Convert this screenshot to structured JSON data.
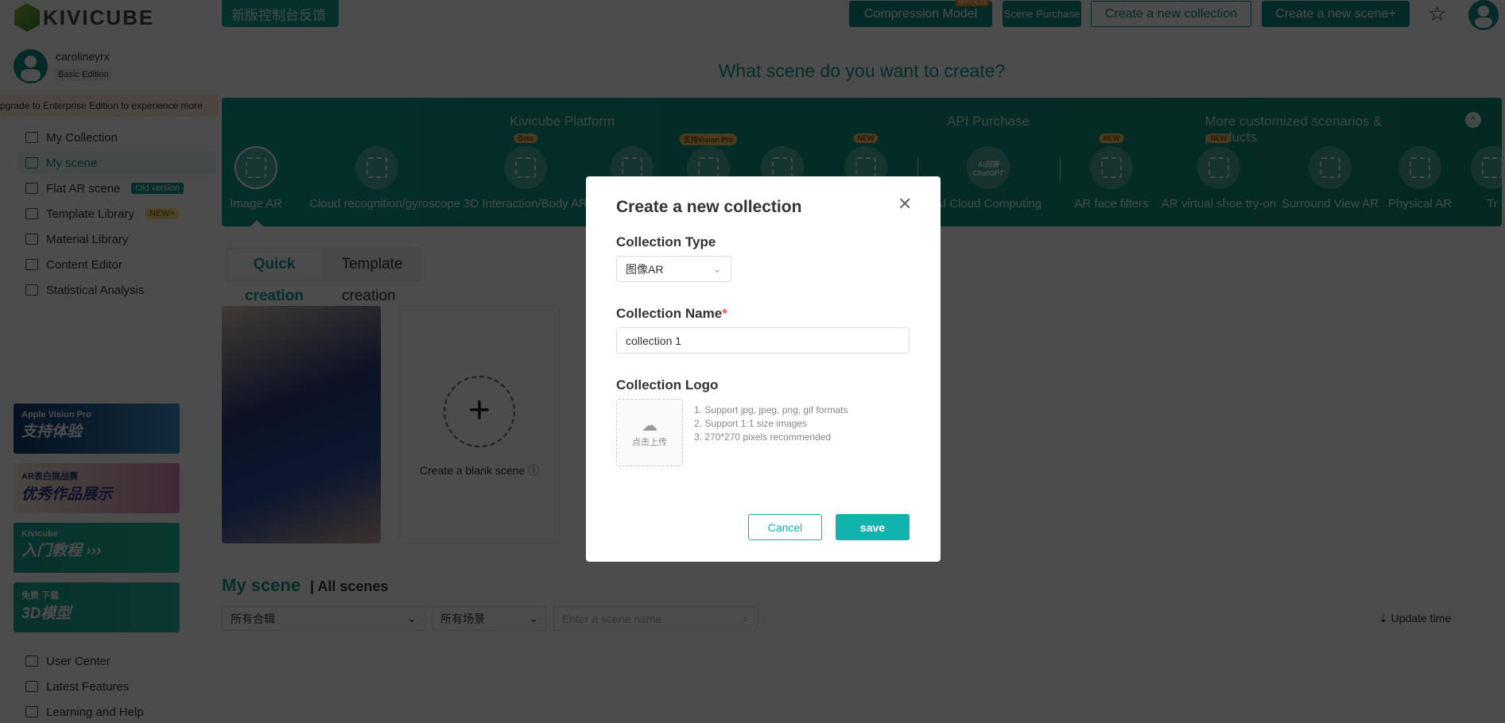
{
  "brand": {
    "name": "KIVICUBE",
    "feedback": "新版控制台反馈"
  },
  "topbar": {
    "compression": "Compression Model",
    "compression_badge": "限时免费",
    "scene_purchase": "Scene Purchase",
    "new_collection": "Create a new collection",
    "new_scene": "Create a new scene+"
  },
  "user": {
    "name": "carolineyrx",
    "edition": "Basic Edition",
    "upgrade": "pgrade to Enterprise Edition to experience more"
  },
  "nav": [
    {
      "label": "My Collection"
    },
    {
      "label": "My scene",
      "active": true
    },
    {
      "label": "Flat AR scene",
      "tag": "Old version"
    },
    {
      "label": "Template Library",
      "tag": "NEW+"
    },
    {
      "label": "Material Library"
    },
    {
      "label": "Content Editor"
    },
    {
      "label": "Statistical Analysis"
    }
  ],
  "banners": [
    {
      "small": "Apple Vision Pro",
      "text": "支持体验"
    },
    {
      "small": "AR表白挑战赛",
      "text": "优秀作品展示"
    },
    {
      "small": "Kivicube",
      "text": "入门教程 ›››"
    },
    {
      "small": "免费 下载",
      "text": "3D模型"
    }
  ],
  "bottom_nav": [
    {
      "label": "User Center"
    },
    {
      "label": "Latest Features"
    },
    {
      "label": "Learning and Help"
    }
  ],
  "main": {
    "heading": "What scene do you want to create?",
    "groups": [
      "Kivicube Platform",
      "API Purchase",
      "More customized scenarios & products"
    ],
    "types": [
      {
        "label": "Image AR",
        "selected": true
      },
      {
        "label": "Cloud recognition/gyroscope"
      },
      {
        "label": "3D Interaction/Body AR",
        "badge": "Beta"
      },
      {
        "label": ""
      },
      {
        "label": "",
        "badge": "支持Vision Pro"
      },
      {
        "label": ""
      },
      {
        "label": "",
        "badge": "NEW"
      },
      {
        "label": "AI Cloud Computing",
        "icon_text": "AI回答 ChatGPT"
      },
      {
        "label": "AR face filters",
        "badge": "NEW"
      },
      {
        "label": "AR virtual shoe try-on",
        "badge": "NEW"
      },
      {
        "label": "Surround View AR"
      },
      {
        "label": "Physical AR"
      },
      {
        "label": "Tr"
      }
    ],
    "tabs": [
      {
        "label": "Quick",
        "sub": "creation",
        "active": true
      },
      {
        "label": "Template",
        "sub": "creation"
      }
    ],
    "blank_scene": "Create a blank scene",
    "my_scene": "My scene",
    "all_scenes": "All scenes",
    "filter_collection": "所有合辑",
    "filter_scene": "所有场景",
    "search_placeholder": "Enter a scene name",
    "sort": "Update time"
  },
  "modal": {
    "title": "Create a new collection",
    "type_label": "Collection Type",
    "type_value": "图像AR",
    "name_label": "Collection Name",
    "required": "*",
    "name_value": "collection 1",
    "logo_label": "Collection Logo",
    "upload": "点击上传",
    "hints": [
      "1. Support jpg, jpeg, png, gif formats",
      "2. Support 1:1 size images",
      "3. 270*270 pixels recommended"
    ],
    "cancel": "Cancel",
    "save": "save"
  },
  "colors": {
    "accent": "#0f9b8e",
    "save": "#12b3ad"
  }
}
